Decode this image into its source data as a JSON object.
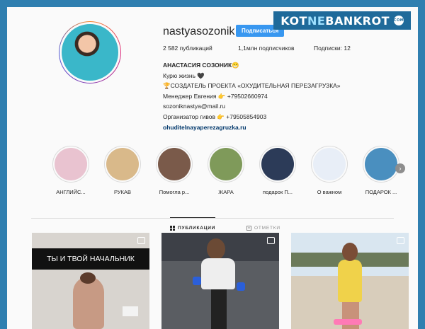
{
  "watermark": {
    "brand_left": "KOT",
    "brand_mid": "NE",
    "brand_right": "BANKROT",
    "badge": "COM"
  },
  "profile": {
    "username": "nastyasozonik",
    "follow_label": "Подписаться",
    "stats": {
      "posts": "2 582 публикаций",
      "followers": "1,1млн подписчиков",
      "following": "Подписки: 12"
    },
    "bio": {
      "name": "АНАСТАСИЯ СОЗОНИК😁",
      "line1": "Курю жизнь 🖤",
      "line2": "🏆СОЗДАТЕЛЬ ПРОЕКТА «ОХУДИТЕЛЬНАЯ ПЕРЕЗАГРУЗКА»",
      "line3": "Менеджер Евгения 👉 +79502660974",
      "line4": "sozoniknastya@mail.ru",
      "line5": "Организатор гивов 👉 +79505854903",
      "link": "ohuditelnayaperezagruzka.ru"
    }
  },
  "highlights": [
    {
      "label": "АНГЛИЙС...",
      "color": "#e9c3d0"
    },
    {
      "label": "РУКАВ",
      "color": "#d9b98a"
    },
    {
      "label": "Помогла р...",
      "color": "#7a5a4a"
    },
    {
      "label": "ЖАРА",
      "color": "#7f9a5a"
    },
    {
      "label": "подарок П...",
      "color": "#2c3b58"
    },
    {
      "label": "О важном",
      "color": "#e8eef7"
    },
    {
      "label": "ПОДАРОК ...",
      "color": "#4a8fbf"
    }
  ],
  "tabs": {
    "posts": "ПУБЛИКАЦИИ",
    "tagged": "ОТМЕТКИ"
  },
  "posts": {
    "post1_caption": "ТЫ И ТВОЙ НАЧАЛЬНИК"
  },
  "icons": [
    "grid-icon",
    "tag-icon",
    "chevron-right-icon",
    "multiple-posts-icon"
  ]
}
